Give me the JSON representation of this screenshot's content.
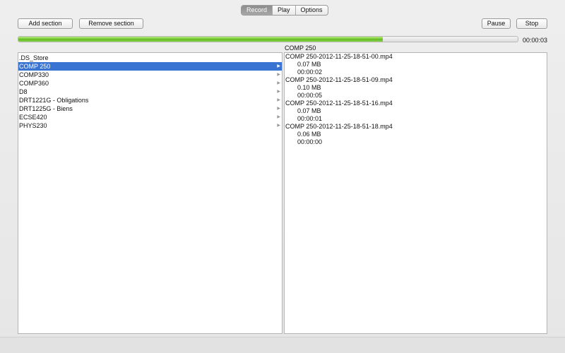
{
  "tabs": [
    {
      "label": "Record",
      "active": true
    },
    {
      "label": "Play",
      "active": false
    },
    {
      "label": "Options",
      "active": false
    }
  ],
  "toolbar": {
    "add_section": "Add section",
    "remove_section": "Remove section",
    "pause": "Pause",
    "stop": "Stop"
  },
  "progress": {
    "value_percent": 73,
    "elapsed": "00:00:03"
  },
  "sections": {
    "items": [
      {
        "label": ".DS_Store",
        "has_children": false
      },
      {
        "label": "COMP 250",
        "has_children": true,
        "selected": true
      },
      {
        "label": "COMP330",
        "has_children": true
      },
      {
        "label": "COMP360",
        "has_children": true
      },
      {
        "label": "D8",
        "has_children": true
      },
      {
        "label": "DRT1221G - Obligations",
        "has_children": true
      },
      {
        "label": "DRT1225G - Biens",
        "has_children": true
      },
      {
        "label": "ECSE420",
        "has_children": true
      },
      {
        "label": "PHYS230",
        "has_children": true
      }
    ]
  },
  "detail": {
    "title": "COMP 250",
    "recordings": [
      {
        "name": "COMP 250-2012-11-25-18-51-00.mp4",
        "size": "0.07 MB",
        "duration": "00:00:02"
      },
      {
        "name": "COMP 250-2012-11-25-18-51-09.mp4",
        "size": "0.10 MB",
        "duration": "00:00:05"
      },
      {
        "name": "COMP 250-2012-11-25-18-51-16.mp4",
        "size": "0.07 MB",
        "duration": "00:00:01"
      },
      {
        "name": "COMP 250-2012-11-25-18-51-18.mp4",
        "size": "0.06 MB",
        "duration": "00:00:00"
      }
    ]
  },
  "colors": {
    "selection": "#3a74d2",
    "progress_green": "#72c62f",
    "window_bg": "#ececec"
  },
  "icons": {
    "disclosure": "chevron-right-icon"
  }
}
